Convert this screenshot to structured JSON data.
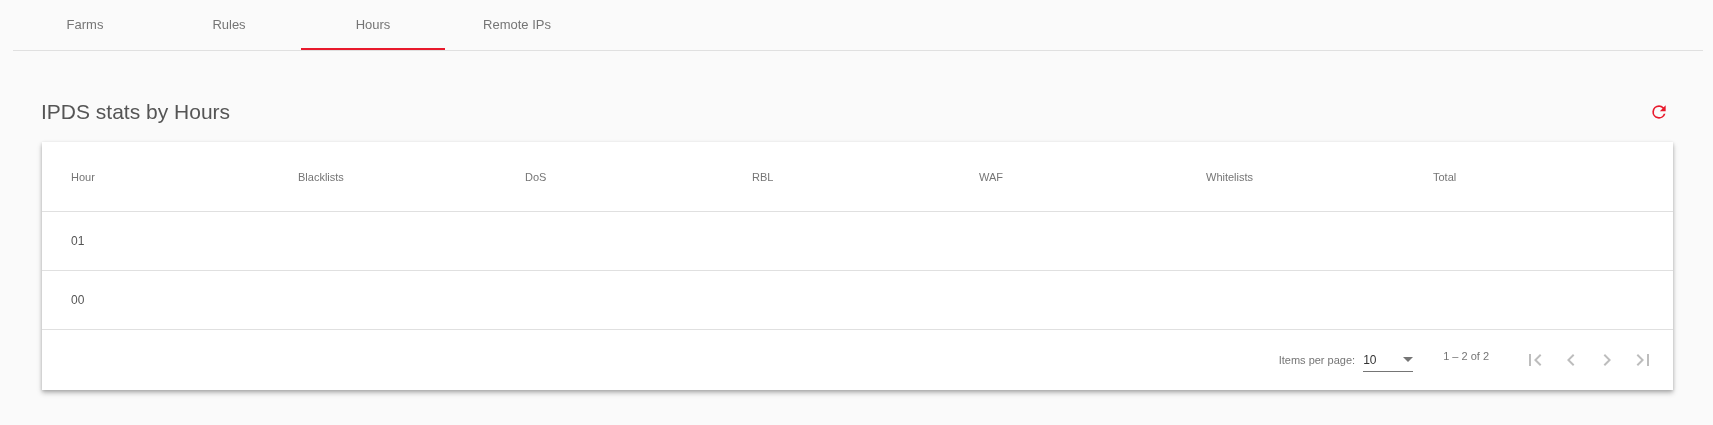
{
  "tabs": [
    {
      "label": "Farms",
      "selected": false
    },
    {
      "label": "Rules",
      "selected": false
    },
    {
      "label": "Hours",
      "selected": true
    },
    {
      "label": "Remote IPs",
      "selected": false
    }
  ],
  "page_title": "IPDS stats by Hours",
  "table": {
    "columns": [
      "Hour",
      "Blacklists",
      "DoS",
      "RBL",
      "WAF",
      "Whitelists",
      "Total"
    ],
    "rows": [
      [
        "01",
        "",
        "",
        "",
        "",
        "",
        ""
      ],
      [
        "00",
        "",
        "",
        "",
        "",
        "",
        ""
      ]
    ]
  },
  "paginator": {
    "items_per_page_label": "Items per page:",
    "page_size": "10",
    "range": "1 – 2 of 2",
    "buttons": [
      {
        "kind": "first",
        "disabled": true
      },
      {
        "kind": "prev",
        "disabled": true
      },
      {
        "kind": "next",
        "disabled": true
      },
      {
        "kind": "last",
        "disabled": true
      }
    ]
  }
}
